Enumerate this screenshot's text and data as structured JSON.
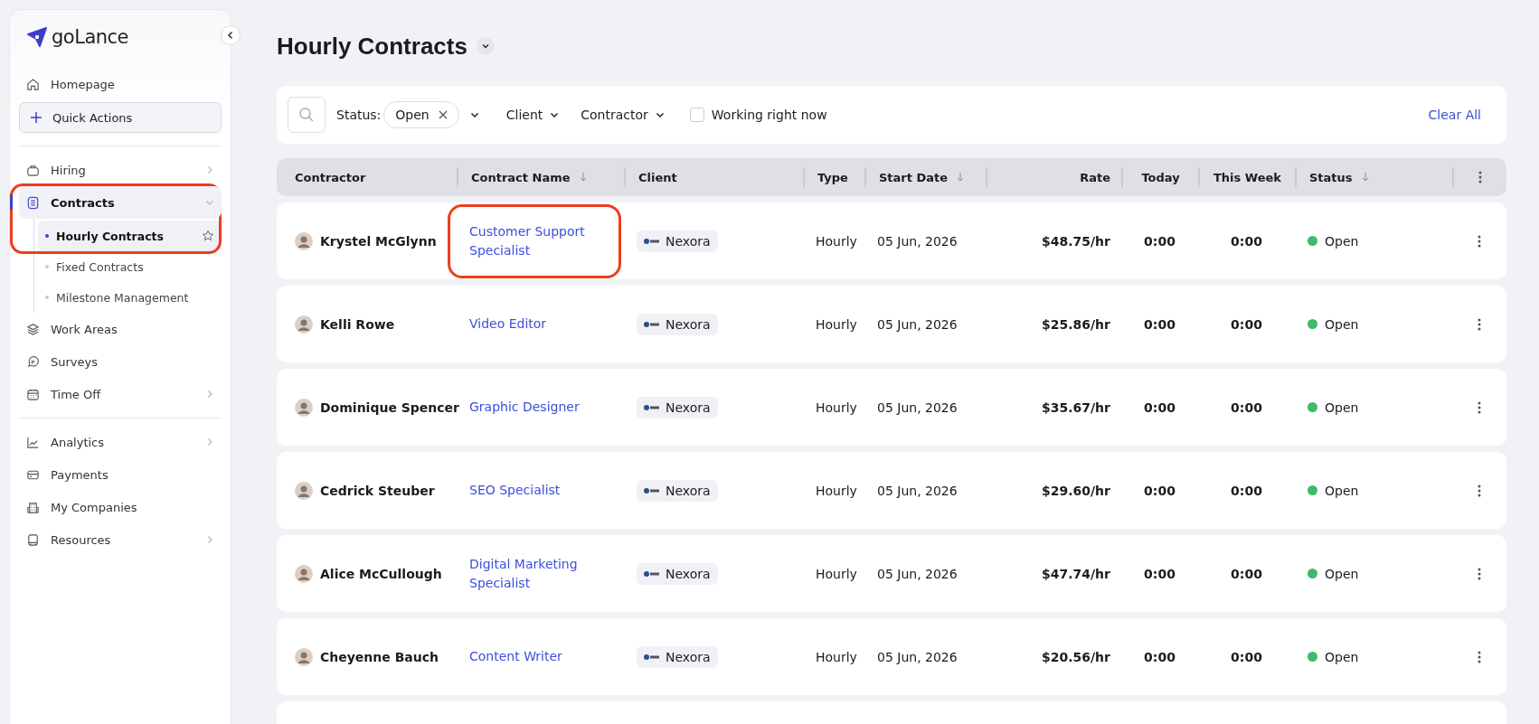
{
  "sidebar": {
    "logo": "goLance",
    "nav": [
      {
        "kind": "link",
        "label": "Homepage",
        "submenu": false
      },
      {
        "kind": "button",
        "label": "Quick Actions"
      },
      {
        "kind": "divider"
      },
      {
        "kind": "link",
        "label": "Hiring",
        "submenu": true
      },
      {
        "kind": "group",
        "label": "Contracts",
        "expanded": true,
        "selected": true,
        "highlighted": true,
        "children": [
          {
            "label": "Hourly Contracts",
            "selected": true
          },
          {
            "label": "Fixed Contracts",
            "selected": false
          },
          {
            "label": "Milestone Management",
            "selected": false
          }
        ]
      },
      {
        "kind": "link",
        "label": "Work Areas",
        "submenu": false
      },
      {
        "kind": "link",
        "label": "Surveys",
        "submenu": false
      },
      {
        "kind": "link",
        "label": "Time Off",
        "submenu": true
      },
      {
        "kind": "divider"
      },
      {
        "kind": "link",
        "label": "Analytics",
        "submenu": true
      },
      {
        "kind": "link",
        "label": "Payments",
        "submenu": false
      },
      {
        "kind": "link",
        "label": "My Companies",
        "submenu": false
      },
      {
        "kind": "link",
        "label": "Resources",
        "submenu": true
      }
    ]
  },
  "page": {
    "title": "Hourly Contracts"
  },
  "filters": {
    "status_label": "Status:",
    "status_chip": "Open",
    "dropdowns": [
      "Client",
      "Contractor"
    ],
    "working_now": {
      "label": "Working right now",
      "checked": false
    },
    "clear": "Clear All"
  },
  "table": {
    "columns": [
      {
        "label": "Contractor",
        "sortable": false
      },
      {
        "label": "Contract Name",
        "sortable": true
      },
      {
        "label": "Client",
        "sortable": false
      },
      {
        "label": "Type",
        "sortable": false
      },
      {
        "label": "Start Date",
        "sortable": true
      },
      {
        "label": "Rate",
        "sortable": false
      },
      {
        "label": "Today",
        "sortable": false
      },
      {
        "label": "This Week",
        "sortable": false
      },
      {
        "label": "Status",
        "sortable": true
      }
    ],
    "rows": [
      {
        "contractor": "Krystel McGlynn",
        "contract_name": "Customer Support Specialist",
        "highlighted": true,
        "client": "Nexora",
        "type": "Hourly",
        "start_date": "05 Jun, 2026",
        "rate": "$48.75/hr",
        "today": "0:00",
        "this_week": "0:00",
        "status": "Open",
        "color": "#3dba6a"
      },
      {
        "contractor": "Kelli Rowe",
        "contract_name": "Video Editor",
        "highlighted": false,
        "client": "Nexora",
        "type": "Hourly",
        "start_date": "05 Jun, 2026",
        "rate": "$25.86/hr",
        "today": "0:00",
        "this_week": "0:00",
        "status": "Open",
        "color": "#3dba6a"
      },
      {
        "contractor": "Dominique Spencer",
        "contract_name": "Graphic Designer",
        "highlighted": false,
        "client": "Nexora",
        "type": "Hourly",
        "start_date": "05 Jun, 2026",
        "rate": "$35.67/hr",
        "today": "0:00",
        "this_week": "0:00",
        "status": "Open",
        "color": "#3dba6a"
      },
      {
        "contractor": "Cedrick Steuber",
        "contract_name": "SEO Specialist",
        "highlighted": false,
        "client": "Nexora",
        "type": "Hourly",
        "start_date": "05 Jun, 2026",
        "rate": "$29.60/hr",
        "today": "0:00",
        "this_week": "0:00",
        "status": "Open",
        "color": "#3dba6a"
      },
      {
        "contractor": "Alice McCullough",
        "contract_name": "Digital Marketing Specialist",
        "highlighted": false,
        "client": "Nexora",
        "type": "Hourly",
        "start_date": "05 Jun, 2026",
        "rate": "$47.74/hr",
        "today": "0:00",
        "this_week": "0:00",
        "status": "Open",
        "color": "#3dba6a"
      },
      {
        "contractor": "Cheyenne Bauch",
        "contract_name": "Content Writer",
        "highlighted": false,
        "client": "Nexora",
        "type": "Hourly",
        "start_date": "05 Jun, 2026",
        "rate": "$20.56/hr",
        "today": "0:00",
        "this_week": "0:00",
        "status": "Open",
        "color": "#3dba6a"
      }
    ]
  }
}
